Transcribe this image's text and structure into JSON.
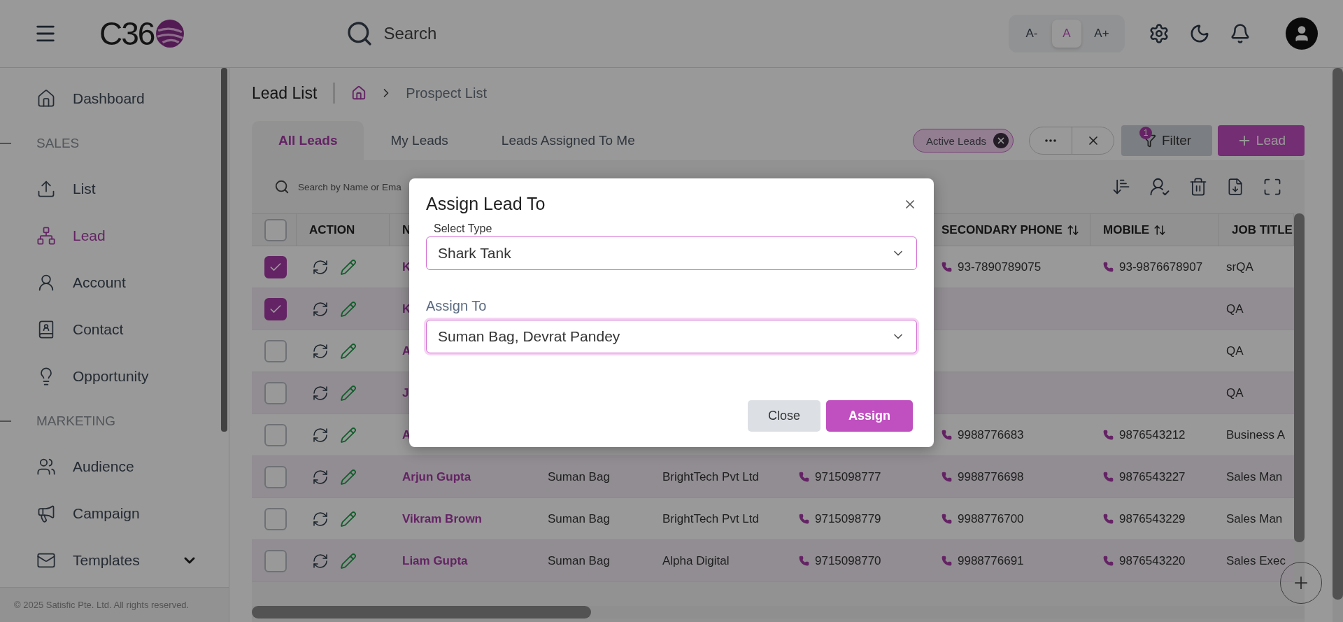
{
  "header": {
    "logo": "C36",
    "search_placeholder": "Search",
    "font_sizes": [
      {
        "label": "A-",
        "selected": false
      },
      {
        "label": "A",
        "selected": true
      },
      {
        "label": "A+",
        "selected": false
      }
    ]
  },
  "sidebar": {
    "items": [
      {
        "kind": "item",
        "label": "Dashboard",
        "selected": false
      },
      {
        "kind": "section",
        "label": "SALES"
      },
      {
        "kind": "item",
        "label": "List",
        "selected": false
      },
      {
        "kind": "item",
        "label": "Lead",
        "selected": true
      },
      {
        "kind": "item",
        "label": "Account",
        "selected": false
      },
      {
        "kind": "item",
        "label": "Contact",
        "selected": false
      },
      {
        "kind": "item",
        "label": "Opportunity",
        "selected": false
      },
      {
        "kind": "section",
        "label": "MARKETING"
      },
      {
        "kind": "item",
        "label": "Audience",
        "selected": false
      },
      {
        "kind": "item",
        "label": "Campaign",
        "selected": false
      },
      {
        "kind": "item",
        "label": "Templates",
        "selected": false,
        "expandable": true
      }
    ],
    "footer": "© 2025 Satisfic Pte. Ltd. All rights reserved."
  },
  "page": {
    "title": "Lead List",
    "breadcrumb": "Prospect List"
  },
  "tabs": [
    {
      "label": "All Leads",
      "selected": true
    },
    {
      "label": "My Leads",
      "selected": false
    },
    {
      "label": "Leads Assigned To Me",
      "selected": false
    }
  ],
  "active_filter": "Active Leads",
  "filter_button": {
    "label": "Filter",
    "badge": "1"
  },
  "add_button": "Lead",
  "table": {
    "search_placeholder": "Search by Name or Ema",
    "header_checked": false,
    "columns": [
      {
        "label": "ACTION"
      },
      {
        "label": "N"
      },
      {
        "label": "SECONDARY PHONE",
        "sortable": true
      },
      {
        "label": "MOBILE",
        "sortable": true
      },
      {
        "label": "JOB TITLE"
      }
    ],
    "rows": [
      {
        "checked": true,
        "name": "K",
        "secondary_phone": "93-7890789075",
        "mobile": "93-9876678907",
        "job_title": "srQA"
      },
      {
        "checked": true,
        "name": "K",
        "job_title": "QA"
      },
      {
        "checked": false,
        "name": "A",
        "job_title": "QA"
      },
      {
        "checked": false,
        "name": "J",
        "job_title": "QA"
      },
      {
        "checked": false,
        "name": "A",
        "secondary_phone": "9988776683",
        "mobile": "9876543212",
        "job_title": "Business A"
      },
      {
        "checked": false,
        "name": "Arjun Gupta",
        "owner": "Suman Bag",
        "company": "BrightTech Pvt Ltd",
        "phone": "9715098777",
        "secondary_phone": "9988776698",
        "mobile": "9876543227",
        "job_title": "Sales Man"
      },
      {
        "checked": false,
        "name": "Vikram Brown",
        "owner": "Suman Bag",
        "company": "BrightTech Pvt Ltd",
        "phone": "9715098779",
        "secondary_phone": "9988776700",
        "mobile": "9876543229",
        "job_title": "Sales Man"
      },
      {
        "checked": false,
        "name": "Liam Gupta",
        "owner": "Suman Bag",
        "company": "Alpha Digital",
        "phone": "9715098770",
        "secondary_phone": "9988776691",
        "mobile": "9876543220",
        "job_title": "Sales Exec"
      }
    ]
  },
  "dialog": {
    "title": "Assign Lead To",
    "fields": [
      {
        "kind": "inset",
        "label": "Select Type",
        "value": "Shark Tank"
      },
      {
        "kind": "above",
        "label": "Assign To",
        "value": "Suman Bag, Devrat Pandey"
      }
    ],
    "buttons": [
      {
        "kind": "secondary",
        "label": "Close"
      },
      {
        "kind": "primary",
        "label": "Assign"
      }
    ]
  }
}
